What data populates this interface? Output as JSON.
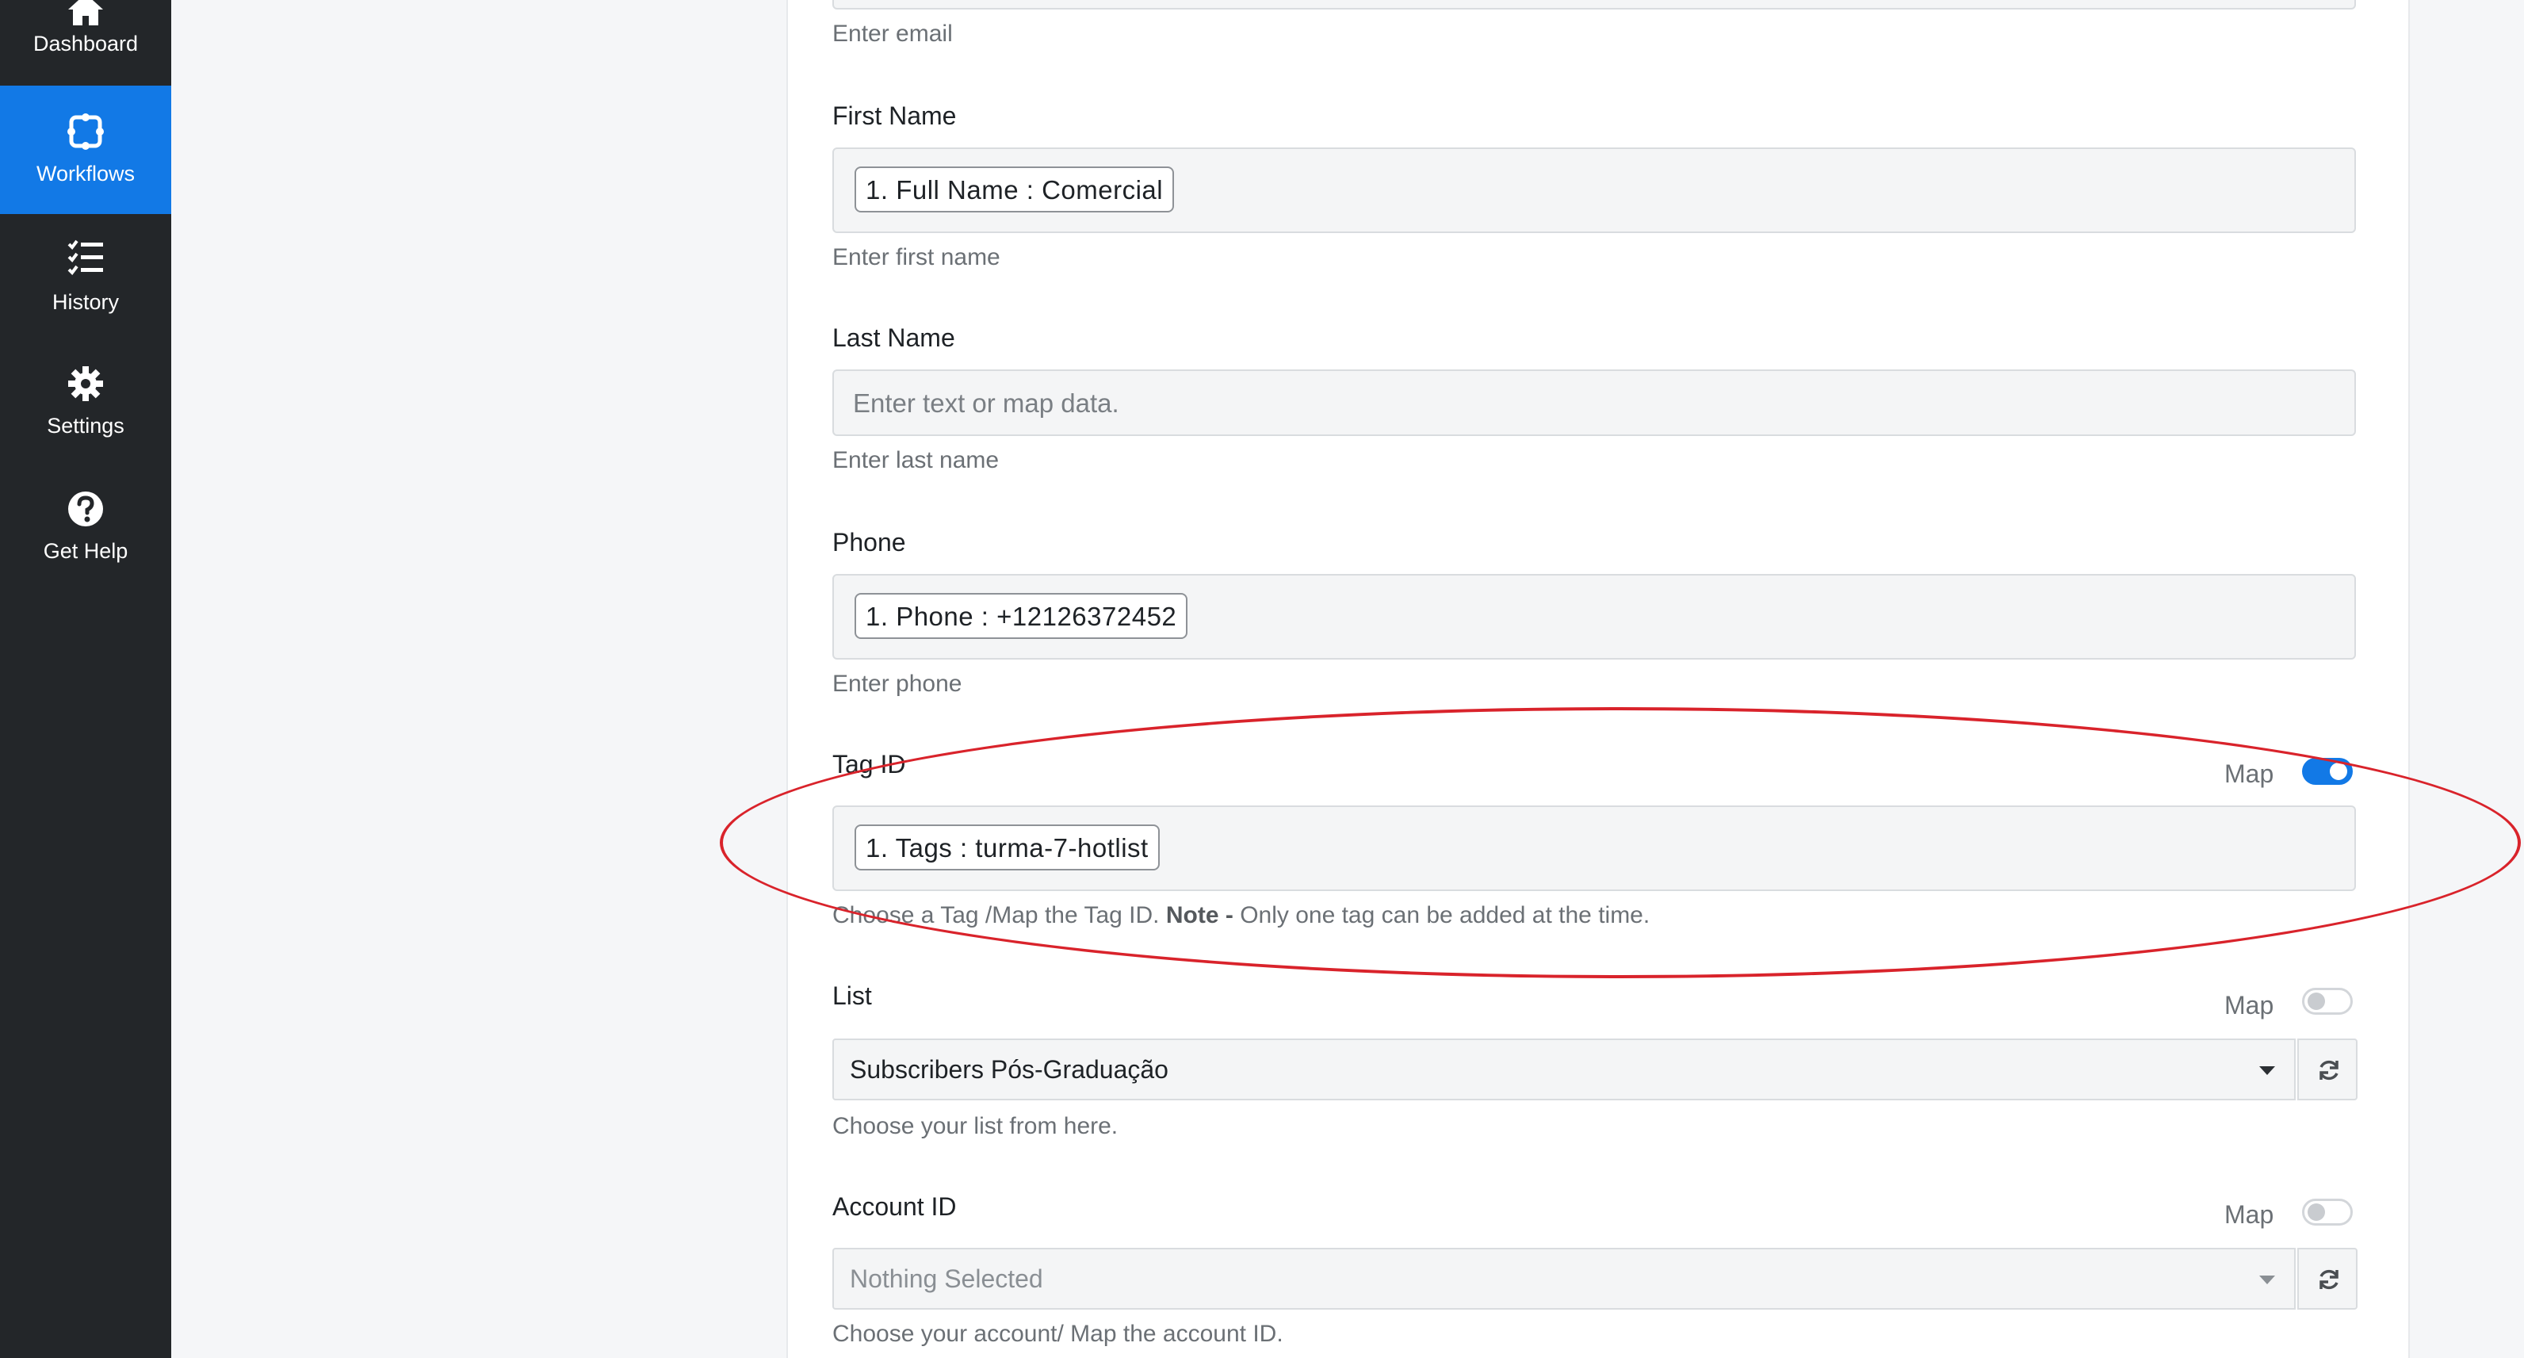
{
  "sidebar": {
    "items": [
      {
        "label": "Dashboard",
        "icon": "home-icon",
        "active": false
      },
      {
        "label": "Workflows",
        "icon": "workflow-icon",
        "active": true
      },
      {
        "label": "History",
        "icon": "list-check-icon",
        "active": false
      },
      {
        "label": "Settings",
        "icon": "gear-icon",
        "active": false
      },
      {
        "label": "Get Help",
        "icon": "question-circle-icon",
        "active": false
      }
    ]
  },
  "form": {
    "email": {
      "help": "Enter email"
    },
    "first_name": {
      "label": "First Name",
      "pill": "1. Full Name : Comercial",
      "help": "Enter first name"
    },
    "last_name": {
      "label": "Last Name",
      "placeholder": "Enter text or map data.",
      "help": "Enter last name"
    },
    "phone": {
      "label": "Phone",
      "pill": "1. Phone : +12126372452",
      "help": "Enter phone"
    },
    "tag_id": {
      "label": "Tag ID",
      "map_label": "Map",
      "map_enabled": true,
      "pill": "1. Tags : turma-7-hotlist",
      "help_prefix": "Choose a Tag /Map the Tag ID.",
      "help_note": "Note -",
      "help_suffix": "Only one tag can be added at the time."
    },
    "list": {
      "label": "List",
      "map_label": "Map",
      "map_enabled": false,
      "selected": "Subscribers Pós-Graduação",
      "help": "Choose your list from here."
    },
    "account_id": {
      "label": "Account ID",
      "map_label": "Map",
      "map_enabled": false,
      "selected": "Nothing Selected",
      "help": "Choose your account/ Map the account ID."
    }
  },
  "colors": {
    "accent": "#1279e6",
    "sidebar": "#232629",
    "highlight": "#d9232b"
  }
}
